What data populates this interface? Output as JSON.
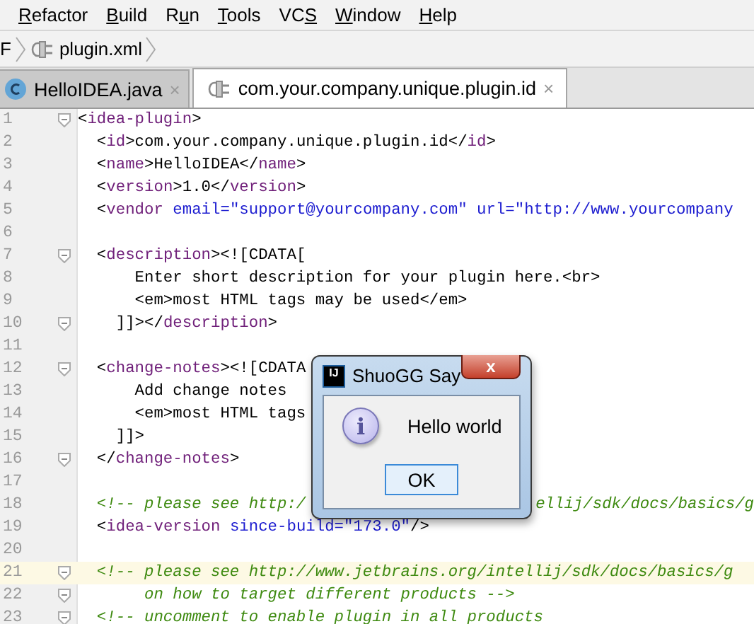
{
  "menu": [
    {
      "key": "R",
      "post": "efactor"
    },
    {
      "key": "B",
      "post": "uild"
    },
    {
      "pre": "R",
      "key": "u",
      "post": "n"
    },
    {
      "key": "T",
      "post": "ools"
    },
    {
      "pre": "VC",
      "key": "S"
    },
    {
      "key": "W",
      "post": "indow"
    },
    {
      "key": "H",
      "post": "elp"
    }
  ],
  "breadcrumbs": [
    {
      "label": "F",
      "kind": "text"
    },
    {
      "label": "plugin.xml",
      "kind": "file"
    }
  ],
  "tabs": [
    {
      "label": "HelloIDEA.java",
      "kind": "java",
      "selected": false,
      "close": "×"
    },
    {
      "label": "com.your.company.unique.plugin.id",
      "kind": "xml",
      "selected": true,
      "close": "×"
    }
  ],
  "editor": {
    "lines": [
      {
        "number": "1",
        "fold": true,
        "current": false,
        "segments": [
          {
            "kind": "punct",
            "text": "<"
          },
          {
            "kind": "tag",
            "text": "idea-plugin"
          },
          {
            "kind": "punct",
            "text": ">"
          }
        ]
      },
      {
        "number": "2",
        "fold": false,
        "current": false,
        "segments": [
          {
            "kind": "punct",
            "text": "  <"
          },
          {
            "kind": "tag",
            "text": "id"
          },
          {
            "kind": "punct",
            "text": ">com.your.company.unique.plugin.id</"
          },
          {
            "kind": "tag",
            "text": "id"
          },
          {
            "kind": "punct",
            "text": ">"
          }
        ]
      },
      {
        "number": "3",
        "fold": false,
        "current": false,
        "segments": [
          {
            "kind": "punct",
            "text": "  <"
          },
          {
            "kind": "tag",
            "text": "name"
          },
          {
            "kind": "punct",
            "text": ">HelloIDEA</"
          },
          {
            "kind": "tag",
            "text": "name"
          },
          {
            "kind": "punct",
            "text": ">"
          }
        ]
      },
      {
        "number": "4",
        "fold": false,
        "current": false,
        "segments": [
          {
            "kind": "punct",
            "text": "  <"
          },
          {
            "kind": "tag",
            "text": "version"
          },
          {
            "kind": "punct",
            "text": ">1.0</"
          },
          {
            "kind": "tag",
            "text": "version"
          },
          {
            "kind": "punct",
            "text": ">"
          }
        ]
      },
      {
        "number": "5",
        "fold": false,
        "current": false,
        "segments": [
          {
            "kind": "punct",
            "text": "  <"
          },
          {
            "kind": "tag",
            "text": "vendor"
          },
          {
            "kind": "attr",
            "text": " email="
          },
          {
            "kind": "value",
            "text": "\"support@yourcompany.com\""
          },
          {
            "kind": "attr",
            "text": " url="
          },
          {
            "kind": "value",
            "text": "\"http://www.yourcompany"
          }
        ]
      },
      {
        "number": "6",
        "fold": false,
        "current": false
      },
      {
        "number": "7",
        "fold": true,
        "current": false,
        "segments": [
          {
            "kind": "punct",
            "text": "  <"
          },
          {
            "kind": "tag",
            "text": "description"
          },
          {
            "kind": "punct",
            "text": "><![CDATA["
          }
        ]
      },
      {
        "number": "8",
        "fold": false,
        "current": false,
        "segments": [
          {
            "kind": "punct",
            "text": "      Enter short description for your plugin here.<br>"
          }
        ]
      },
      {
        "number": "9",
        "fold": false,
        "current": false,
        "segments": [
          {
            "kind": "punct",
            "text": "      <em>most HTML tags may be used</em>"
          }
        ]
      },
      {
        "number": "10",
        "fold": true,
        "current": false,
        "segments": [
          {
            "kind": "punct",
            "text": "    ]]></"
          },
          {
            "kind": "tag",
            "text": "description"
          },
          {
            "kind": "punct",
            "text": ">"
          }
        ]
      },
      {
        "number": "11",
        "fold": false,
        "current": false
      },
      {
        "number": "12",
        "fold": true,
        "current": false,
        "segments": [
          {
            "kind": "punct",
            "text": "  <"
          },
          {
            "kind": "tag",
            "text": "change-notes"
          },
          {
            "kind": "punct",
            "text": "><![CDATA"
          }
        ]
      },
      {
        "number": "13",
        "fold": false,
        "current": false,
        "segments": [
          {
            "kind": "punct",
            "text": "      Add change notes"
          }
        ]
      },
      {
        "number": "14",
        "fold": false,
        "current": false,
        "segments": [
          {
            "kind": "punct",
            "text": "      <em>most HTML tags"
          }
        ]
      },
      {
        "number": "15",
        "fold": false,
        "current": false,
        "segments": [
          {
            "kind": "punct",
            "text": "    ]]>"
          }
        ]
      },
      {
        "number": "16",
        "fold": true,
        "current": false,
        "segments": [
          {
            "kind": "punct",
            "text": "  </"
          },
          {
            "kind": "tag",
            "text": "change-notes"
          },
          {
            "kind": "punct",
            "text": ">"
          }
        ]
      },
      {
        "number": "17",
        "fold": false,
        "current": false
      },
      {
        "number": "18",
        "fold": false,
        "current": false,
        "segments": [
          {
            "kind": "comment",
            "text": "  <!-- please see http:/"
          }
        ],
        "right": [
          {
            "kind": "comment",
            "text": "ellij/sdk/docs/basics/g"
          }
        ]
      },
      {
        "number": "19",
        "fold": false,
        "current": false,
        "segments": [
          {
            "kind": "punct",
            "text": "  <"
          },
          {
            "kind": "tag",
            "text": "idea-version"
          },
          {
            "kind": "attr",
            "text": " since-build="
          },
          {
            "kind": "value",
            "text": "\"173.0\""
          },
          {
            "kind": "punct",
            "text": "/>"
          }
        ]
      },
      {
        "number": "20",
        "fold": false,
        "current": false
      },
      {
        "number": "21",
        "fold": true,
        "current": true,
        "segments": [
          {
            "kind": "comment",
            "text": "  <!-- please see http://www.jetbrains.org/intellij/sdk/docs/basics/g"
          }
        ]
      },
      {
        "number": "22",
        "fold": true,
        "current": false,
        "segments": [
          {
            "kind": "comment",
            "text": "       on how to target different products -->"
          }
        ]
      },
      {
        "number": "23",
        "fold": true,
        "current": false,
        "segments": [
          {
            "kind": "comment",
            "text": "  <!-- uncomment to enable plugin in all products"
          }
        ]
      }
    ]
  },
  "dialog": {
    "title": "ShuoGG Say",
    "app_icon": "IJ",
    "close": "x",
    "message": "Hello world",
    "info_icon": "i",
    "buttons": [
      "OK"
    ]
  }
}
